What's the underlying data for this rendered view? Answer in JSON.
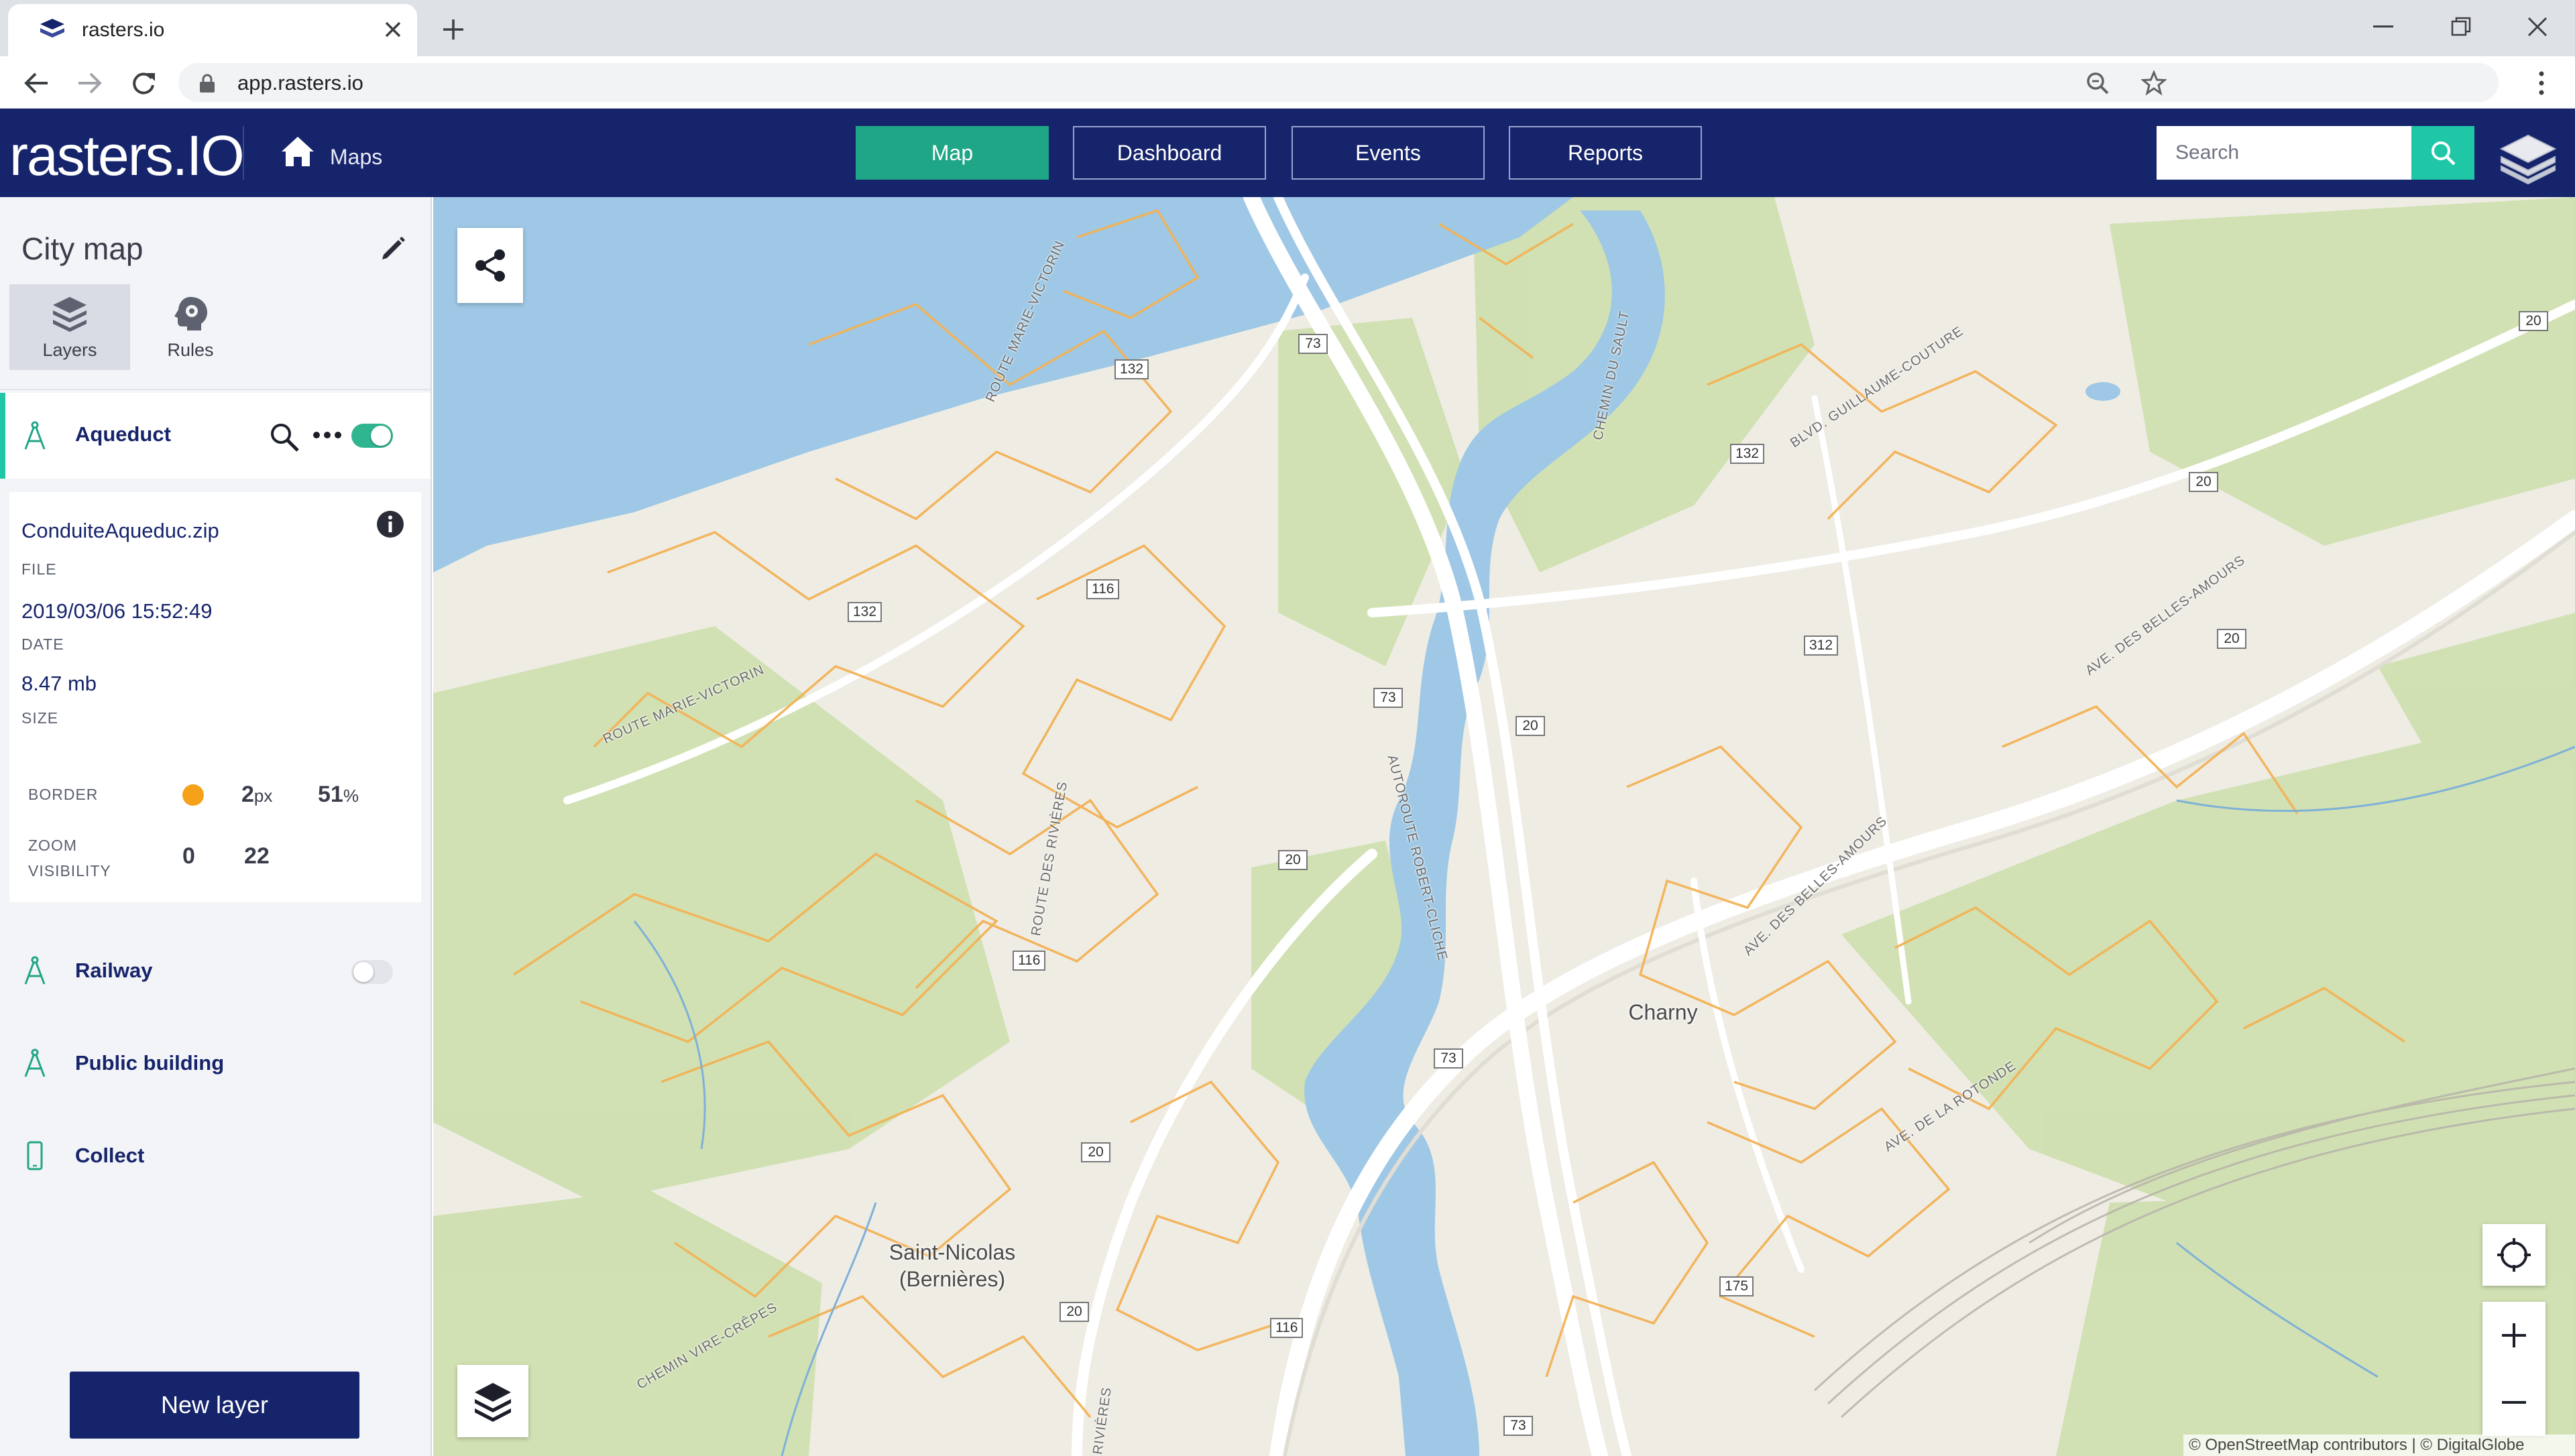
{
  "browser": {
    "tab_title": "rasters.io",
    "url": "app.rasters.io"
  },
  "header": {
    "logo": "rasters.IO",
    "maps_link": "Maps",
    "nav": {
      "map": "Map",
      "dashboard": "Dashboard",
      "events": "Events",
      "reports": "Reports"
    },
    "search_placeholder": "Search",
    "accent_color": "#1fa686",
    "brand_color": "#16246b"
  },
  "sidebar": {
    "title": "City map",
    "tabs": {
      "layers": "Layers",
      "rules": "Rules"
    },
    "active_layer": {
      "name": "Aqueduct",
      "enabled": true,
      "file_value": "ConduiteAqueduc.zip",
      "file_key": "FILE",
      "date_value": "2019/03/06 15:52:49",
      "date_key": "DATE",
      "size_value": "8.47 mb",
      "size_key": "SIZE",
      "border_key": "BORDER",
      "border_color": "#f5a11a",
      "border_width_value": "2",
      "border_width_unit": "px",
      "opacity_value": "51",
      "opacity_unit": "%",
      "zoom_key_line1": "ZOOM",
      "zoom_key_line2": "VISIBILITY",
      "zoom_min": "0",
      "zoom_max": "22"
    },
    "layers": [
      {
        "name": "Railway",
        "toggle": false
      },
      {
        "name": "Public building"
      },
      {
        "name": "Collect"
      }
    ],
    "new_layer": "New layer"
  },
  "map": {
    "places": {
      "charny": "Charny",
      "saint_nicolas_1": "Saint-Nicolas",
      "saint_nicolas_2": "(Bernières)"
    },
    "roads": {
      "route_marie_victorin_1": "ROUTE MARIE-VICTORIN",
      "route_marie_victorin_2": "ROUTE MARIE-VICTORIN",
      "route_des_rivieres": "ROUTE DES RIVIÈRES",
      "autoroute_robert_cliche": "AUTOROUTE ROBERT-CLICHE",
      "chemin_du_sault": "CHEMIN DU SAULT",
      "blvd_guillaume_couture": "BLVD. GUILLAUME-COUTURE",
      "ave_belles_amours_1": "AVE. DES BELLES-AMOURS",
      "ave_belles_amours_2": "AVE. DES BELLES-AMOURS",
      "ave_rotonde": "AVE. DE LA ROTONDE",
      "chemin_vire_crepes": "CHEMIN VIRE-CRÊPES",
      "rivieres_bottom": "RIVIÈRES"
    },
    "shields": {
      "s73a": "73",
      "s132a": "132",
      "s132b": "132",
      "s132c": "132",
      "s116a": "116",
      "s116b": "116",
      "s116c": "116",
      "s73b": "73",
      "s20a": "20",
      "s20b": "20",
      "s20c": "20",
      "s20d": "20",
      "s20e": "20",
      "s20f": "20",
      "s20g": "20",
      "s312": "312",
      "s73c": "73",
      "s73d": "73",
      "s175": "175"
    },
    "attribution": "© OpenStreetMap contributors | © DigitalGlobe"
  }
}
